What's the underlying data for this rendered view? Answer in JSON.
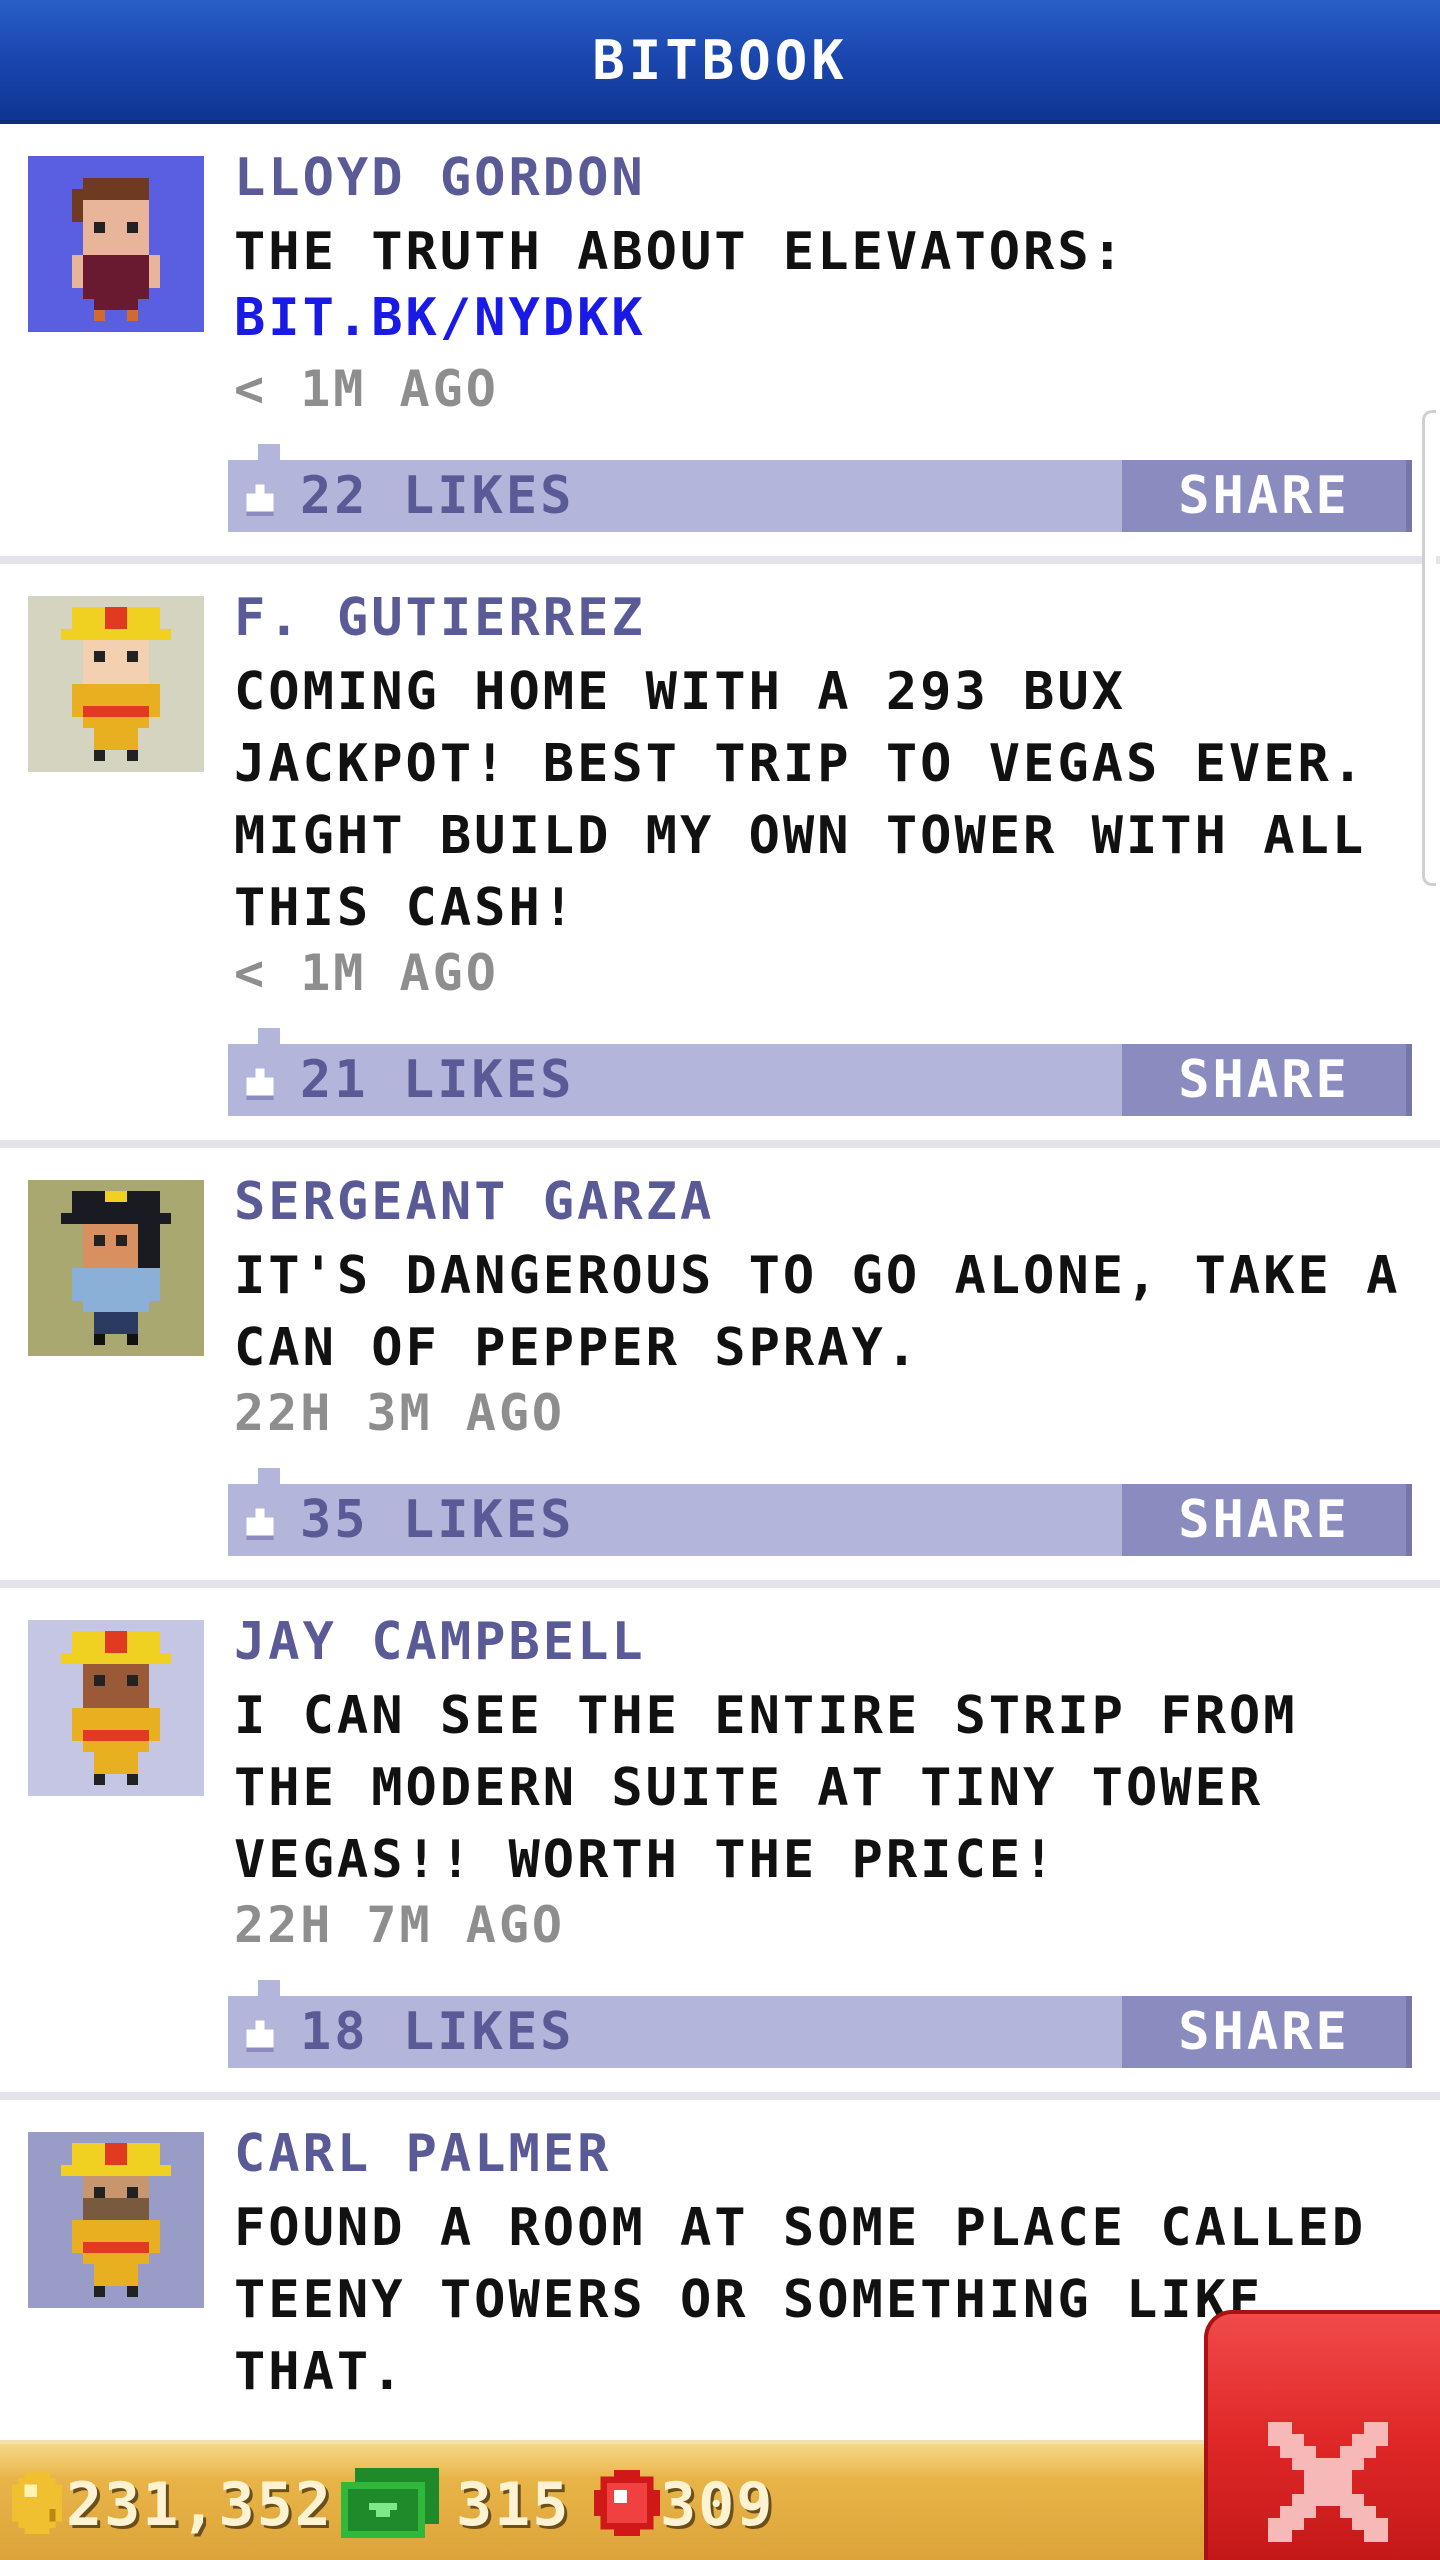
{
  "header": {
    "title": "BITBOOK"
  },
  "posts": [
    {
      "author": "LLOYD GORDON",
      "text": "THE TRUTH ABOUT ELEVATORS:",
      "link": "BIT.BK/NYDKK",
      "time": "< 1M AGO",
      "likes": "22 LIKES",
      "share": "SHARE",
      "avatar_bg": "#5a5ee0",
      "avatar": "character-brown-hair-maroon-shirt"
    },
    {
      "author": "F. GUTIERREZ",
      "text": "COMING HOME WITH A 293 BUX JACKPOT! BEST TRIP TO VEGAS EVER. MIGHT BUILD MY OWN TOWER WITH ALL THIS CASH!",
      "time": "< 1M AGO",
      "likes": "21 LIKES",
      "share": "SHARE",
      "avatar_bg": "#d4d4c0",
      "avatar": "firefighter-character"
    },
    {
      "author": "SERGEANT GARZA",
      "text": "IT'S DANGEROUS TO GO ALONE, TAKE A CAN OF PEPPER SPRAY.",
      "time": "22H 3M AGO",
      "likes": "35 LIKES",
      "share": "SHARE",
      "avatar_bg": "#a8a870",
      "avatar": "police-officer-character"
    },
    {
      "author": "JAY CAMPBELL",
      "text": "I CAN SEE THE ENTIRE STRIP FROM THE MODERN SUITE AT TINY TOWER VEGAS!! WORTH THE PRICE!",
      "time": "22H 7M AGO",
      "likes": "18 LIKES",
      "share": "SHARE",
      "avatar_bg": "#c4c6e4",
      "avatar": "firefighter-character"
    },
    {
      "author": "CARL PALMER",
      "text": "FOUND A ROOM AT SOME PLACE CALLED TEENY TOWERS OR SOMETHING LIKE THAT.",
      "avatar_bg": "#9a9cc8",
      "avatar": "firefighter-character"
    }
  ],
  "status": {
    "coins": "231,352",
    "bux": "315",
    "gems": "309"
  },
  "colors": {
    "header": "#1a48b0",
    "author": "#5a5a96",
    "link": "#1a1ae6",
    "like_bar": "#b3b5da",
    "share_button": "#8a8cc0",
    "status_bar": "#e8b448",
    "close_button": "#e02828"
  },
  "icons": {
    "like": "like-hand-icon",
    "coin": "coin-icon",
    "bux": "bux-icon",
    "gem": "gem-icon",
    "close": "close-icon"
  }
}
